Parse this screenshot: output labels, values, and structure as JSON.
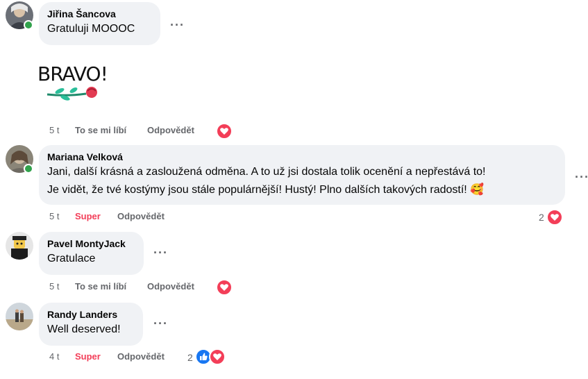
{
  "comments": [
    {
      "author": "Jiřina Šancova",
      "text": "Gratuluji MOOOC",
      "sticker_text": "BRAVO!",
      "time": "5 t",
      "reaction_label": "To se mi líbí",
      "reply_label": "Odpovědět",
      "reactions": [
        "heart-icon"
      ]
    },
    {
      "author": "Mariana Velková",
      "text_line1": "Jani, další krásná a zasloužená odměna. A to už jsi dostala tolik ocenění a nepřestává to!",
      "text_line2": "Je vidět, že tvé kostýmy jsou stále populárnější! Hustý! Plno dalších takových radostí! 🥰",
      "time": "5 t",
      "reaction_label": "Super",
      "reply_label": "Odpovědět",
      "reaction_count": "2",
      "reactions": [
        "heart-icon"
      ]
    },
    {
      "author": "Pavel MontyJack",
      "text": "Gratulace",
      "time": "5 t",
      "reaction_label": "To se mi líbí",
      "reply_label": "Odpovědět",
      "reactions": [
        "heart-icon"
      ]
    },
    {
      "author": "Randy Landers",
      "text": "Well deserved!",
      "time": "4 t",
      "reaction_label": "Super",
      "reply_label": "Odpovědět",
      "reaction_count": "2",
      "reactions": [
        "thumbs-up-icon",
        "heart-icon"
      ]
    }
  ],
  "more_label": "···",
  "colors": {
    "bubble": "#f0f2f5",
    "secondary_text": "#65676b",
    "super": "#f33e58",
    "like": "#1877f2",
    "online": "#31a24c"
  }
}
